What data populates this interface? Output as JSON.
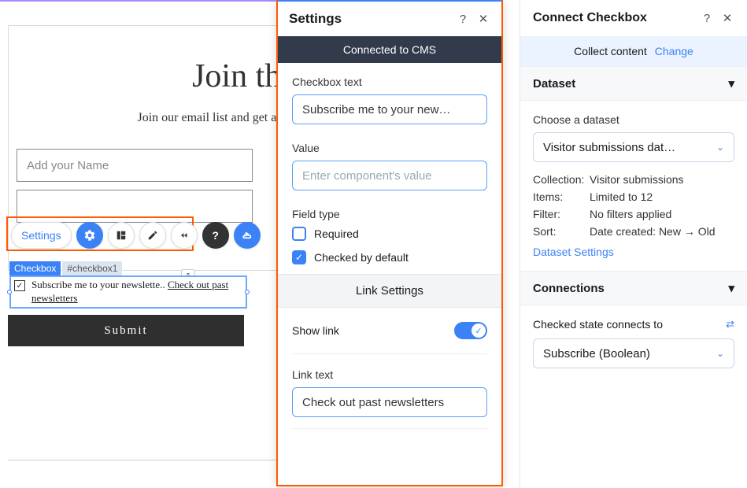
{
  "canvas": {
    "title": "Join the",
    "subtitle": "Join our email list and get access to specia",
    "name_placeholder": "Add your Name",
    "tags": {
      "type": "Checkbox",
      "id": "#checkbox1"
    },
    "checkbox_text": "Subscribe me to your newslette",
    "checkbox_link": "Check out past newsletters",
    "submit_label": "Submit"
  },
  "toolbar": {
    "settings_label": "Settings"
  },
  "settings": {
    "title": "Settings",
    "connected_banner": "Connected to CMS",
    "checkbox_text_label": "Checkbox text",
    "checkbox_text_value": "Subscribe me to your new…",
    "value_label": "Value",
    "value_placeholder": "Enter component's value",
    "field_type_label": "Field type",
    "required_label": "Required",
    "required_checked": false,
    "checked_default_label": "Checked by default",
    "checked_default_checked": true,
    "link_settings_header": "Link Settings",
    "show_link_label": "Show link",
    "show_link_on": true,
    "link_text_label": "Link text",
    "link_text_value": "Check out past newsletters"
  },
  "connect": {
    "title": "Connect Checkbox",
    "collect_label": "Collect content",
    "change_label": "Change",
    "dataset_header": "Dataset",
    "choose_dataset_label": "Choose a dataset",
    "dataset_selected": "Visitor submissions dat…",
    "meta": {
      "collection_k": "Collection:",
      "collection_v": "Visitor submissions",
      "items_k": "Items:",
      "items_v": "Limited to 12",
      "filter_k": "Filter:",
      "filter_v": "No filters applied",
      "sort_k": "Sort:",
      "sort_v": "Date created: New → Old"
    },
    "dataset_settings_link": "Dataset Settings",
    "connections_header": "Connections",
    "checked_state_label": "Checked state connects to",
    "checked_state_value": "Subscribe (Boolean)"
  }
}
